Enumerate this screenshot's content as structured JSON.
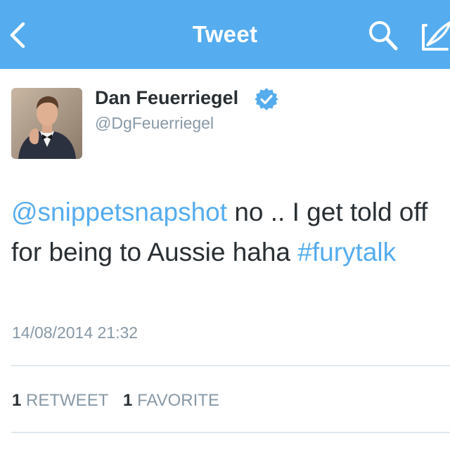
{
  "colors": {
    "accent": "#55acee",
    "text_primary": "#292f33",
    "text_secondary": "#8899a6",
    "divider": "#e1e8ed"
  },
  "navbar": {
    "title": "Tweet",
    "back_icon": "chevron-left-icon",
    "search_icon": "search-icon",
    "compose_icon": "compose-icon"
  },
  "author": {
    "name": "Dan Feuerriegel",
    "handle": "@DgFeuerriegel",
    "verified": true
  },
  "tweet": {
    "mention": "@snippetsnapshot",
    "text": " no .. I get told off for being to Aussie haha ",
    "hashtag": "#furytalk",
    "timestamp": "14/08/2014 21:32"
  },
  "stats": {
    "retweets_count": "1",
    "retweets_label": "RETWEET",
    "favorites_count": "1",
    "favorites_label": "FAVORITE"
  }
}
